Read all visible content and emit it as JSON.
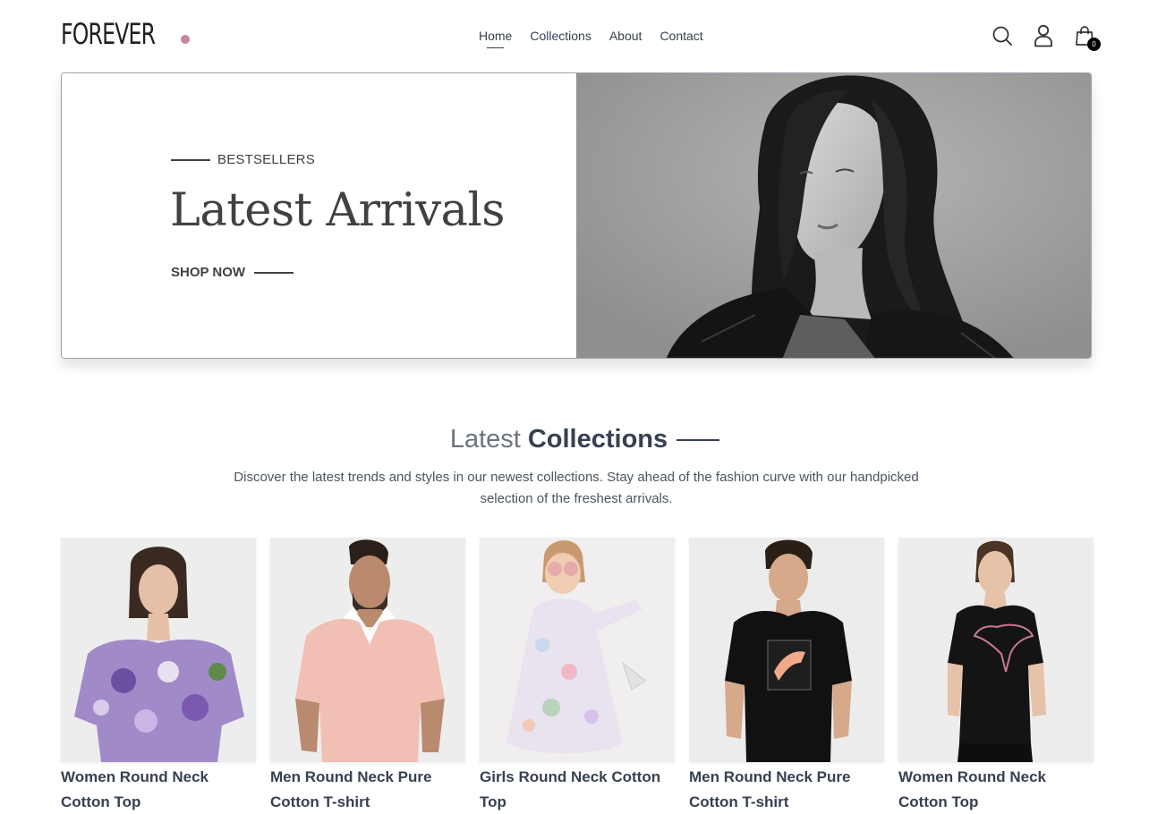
{
  "brand": {
    "name": "FOREVER",
    "dot_color": "#c586a5"
  },
  "nav": {
    "items": [
      {
        "label": "Home",
        "active": true
      },
      {
        "label": "Collections",
        "active": false
      },
      {
        "label": "About",
        "active": false
      },
      {
        "label": "Contact",
        "active": false
      }
    ]
  },
  "header_icons": {
    "search": "search-icon",
    "profile": "user-icon",
    "cart": "shopping-bag-icon",
    "cart_count": "0"
  },
  "hero": {
    "eyebrow": "BESTSELLERS",
    "title": "Latest Arrivals",
    "cta": "SHOP NOW",
    "image": "black-and-white model portrait in leather jacket"
  },
  "latest_collections": {
    "title_light": "Latest",
    "title_bold": "Collections",
    "description": "Discover the latest trends and styles in our newest collections. Stay ahead of the fashion curve with our handpicked selection of the freshest arrivals."
  },
  "products": [
    {
      "name": "Women Round Neck Cotton Top"
    },
    {
      "name": "Men Round Neck Pure Cotton T-shirt"
    },
    {
      "name": "Girls Round Neck Cotton Top"
    },
    {
      "name": "Men Round Neck Pure Cotton T-shirt"
    },
    {
      "name": "Women Round Neck Cotton Top"
    }
  ]
}
